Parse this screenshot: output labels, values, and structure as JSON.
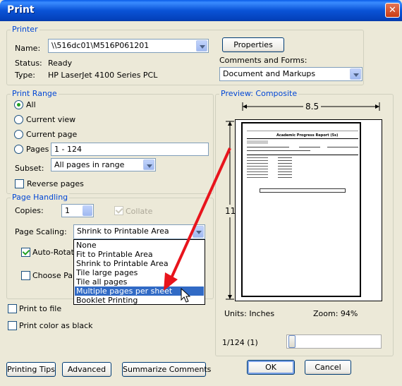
{
  "window": {
    "title": "Print",
    "close_glyph": "✕"
  },
  "printer": {
    "legend": "Printer",
    "name_label": "Name:",
    "name_value": "\\\\516dc01\\M516P061201",
    "status_label": "Status:",
    "status_value": "Ready",
    "type_label": "Type:",
    "type_value": "HP LaserJet 4100 Series PCL",
    "properties_button": "Properties",
    "comments_label": "Comments and Forms:",
    "comments_value": "Document and Markups"
  },
  "print_range": {
    "legend": "Print Range",
    "all": "All",
    "current_view": "Current view",
    "current_page": "Current page",
    "pages": "Pages",
    "pages_value": "1 - 124",
    "subset_label": "Subset:",
    "subset_value": "All pages in range",
    "reverse_pages": "Reverse pages",
    "selected": "all"
  },
  "page_handling": {
    "legend": "Page Handling",
    "copies_label": "Copies:",
    "copies_value": "1",
    "collate": "Collate",
    "scaling_label": "Page Scaling:",
    "scaling_value": "Shrink to Printable Area",
    "auto_rotate": "Auto-Rotate",
    "choose_paper": "Choose Pap",
    "scaling_options": [
      "None",
      "Fit to Printable Area",
      "Shrink to Printable Area",
      "Tile large pages",
      "Tile all pages",
      "Multiple pages per sheet",
      "Booklet Printing"
    ],
    "highlighted_option_index": 5
  },
  "bottom_options": {
    "print_to_file": "Print to file",
    "print_color_black": "Print color as black"
  },
  "preview": {
    "legend": "Preview: Composite",
    "width_label": "8.5",
    "height_label": "11",
    "units": "Units: Inches",
    "zoom": "Zoom:  94%",
    "page_counter": "1/124 (1)",
    "doc_header": "Academic Progress Report (5s)"
  },
  "buttons": {
    "printing_tips": "Printing Tips",
    "advanced": "Advanced",
    "summarize_comments": "Summarize Comments",
    "ok": "OK",
    "cancel": "Cancel"
  },
  "colors": {
    "accent": "#0046d5",
    "selection": "#316ac5",
    "arrow": "#e8141c"
  }
}
